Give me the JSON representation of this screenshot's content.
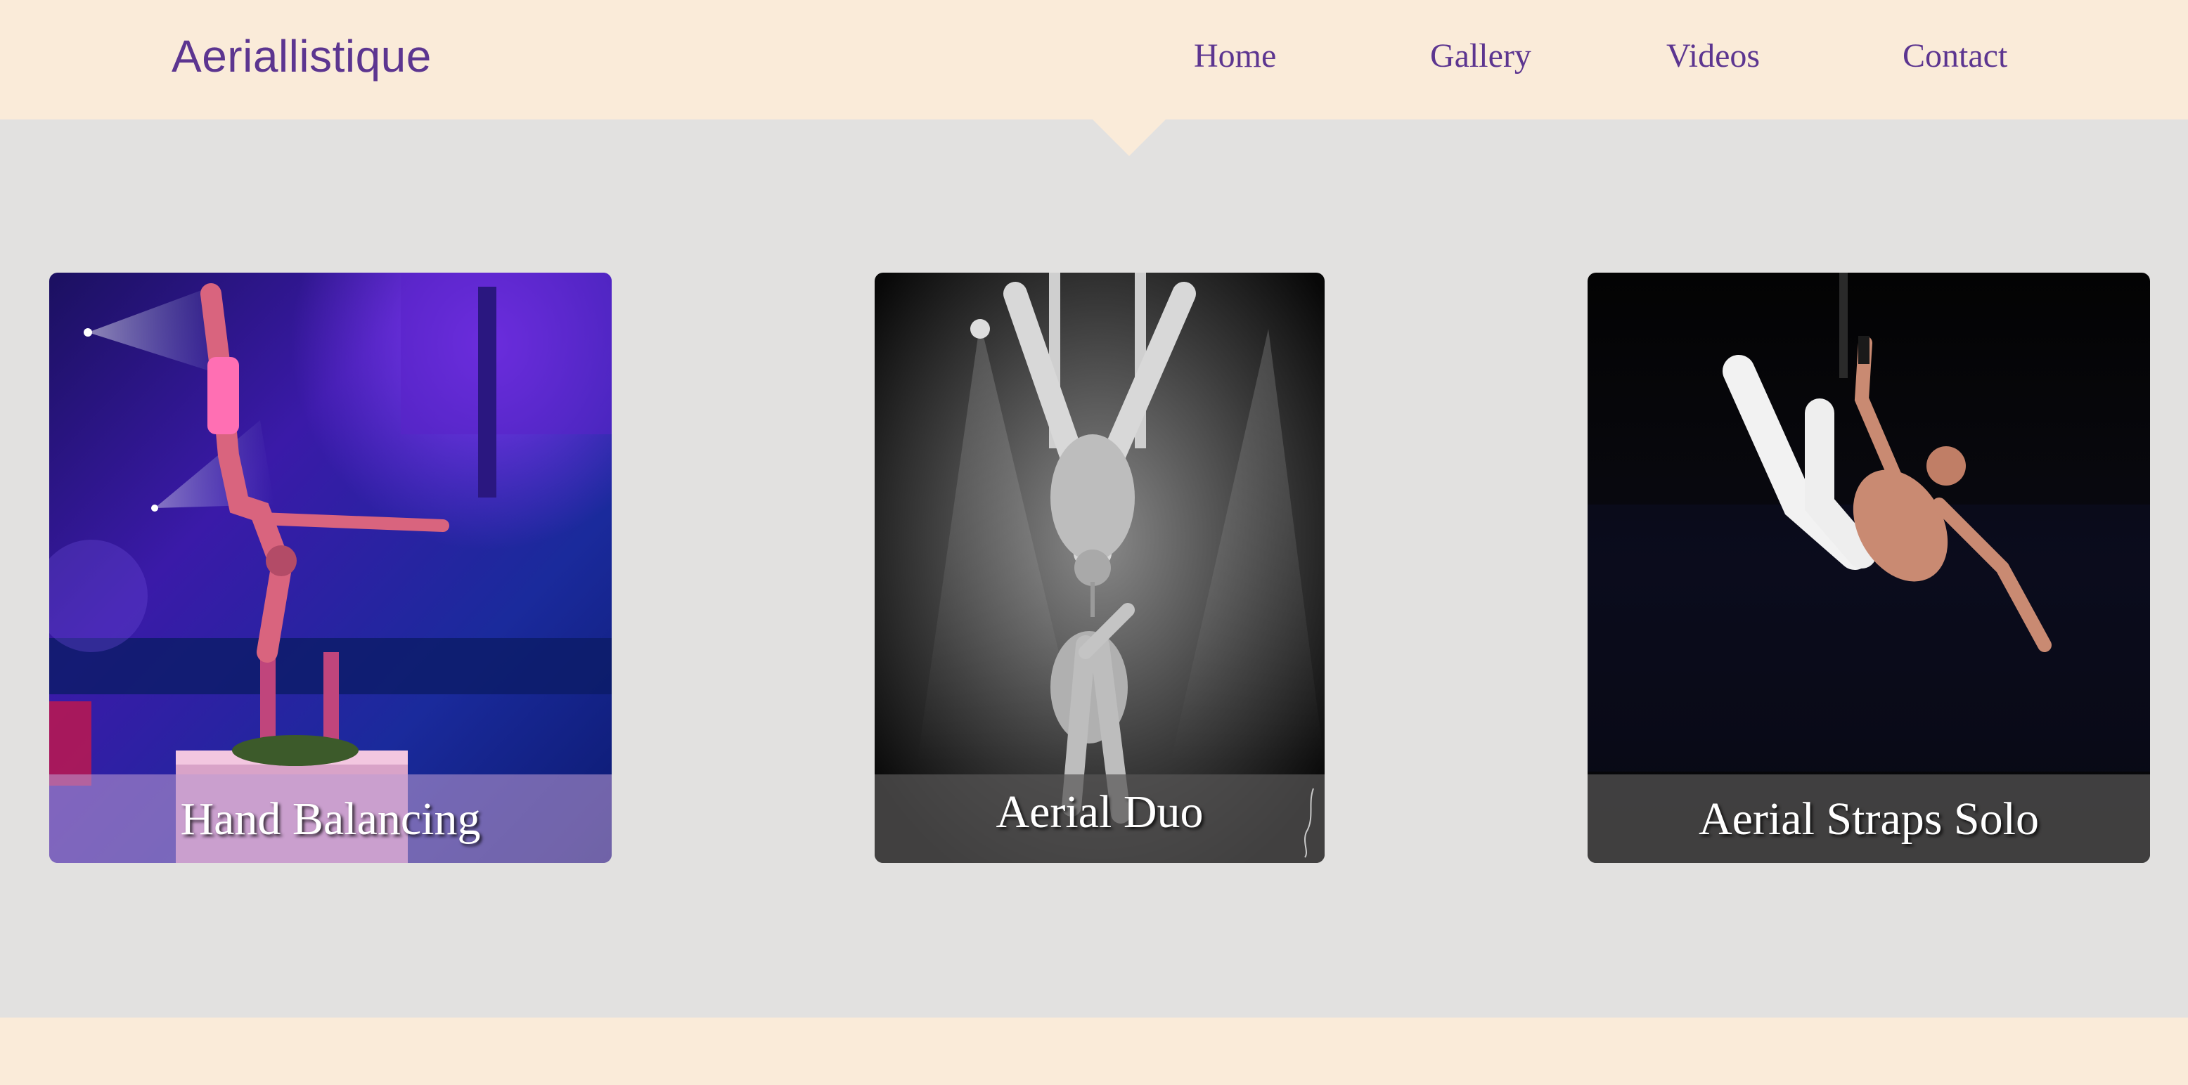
{
  "header": {
    "brand": "Aeriallistique",
    "nav": {
      "home": "Home",
      "gallery": "Gallery",
      "videos": "Videos",
      "contact": "Contact"
    },
    "active_item": "Home"
  },
  "gallery": {
    "items": [
      {
        "caption": "Hand Balancing"
      },
      {
        "caption": "Aerial Duo"
      },
      {
        "caption": "Aerial Straps Solo"
      }
    ]
  },
  "colors": {
    "header_bg": "#faebd9",
    "page_bg": "#e2e1e0",
    "accent": "#5c3590",
    "caption_text": "#ffffff"
  }
}
